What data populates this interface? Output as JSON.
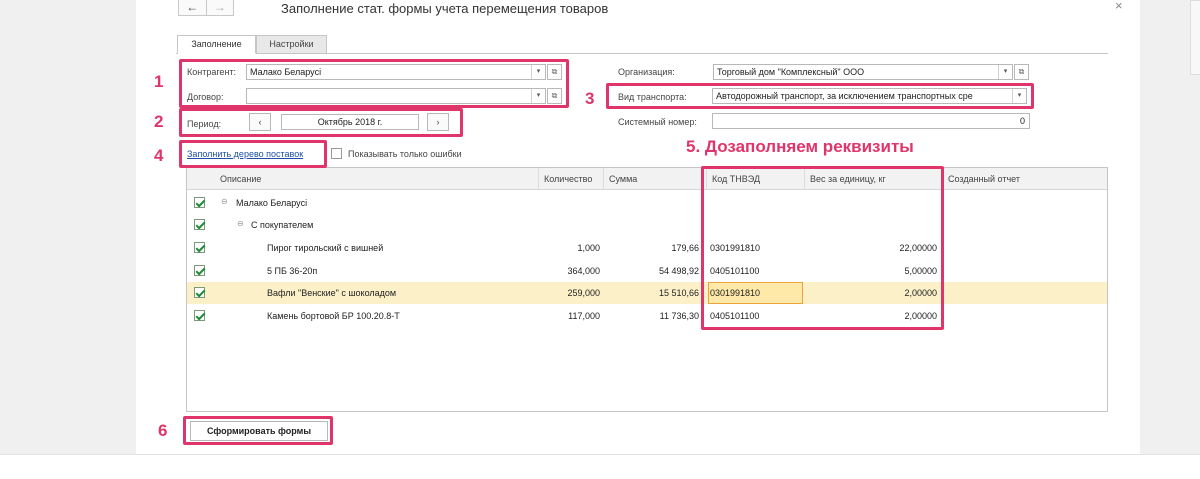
{
  "window": {
    "title": "Заполнение стат. формы учета перемещения товаров",
    "nav_back": "←",
    "nav_forward": "→",
    "close": "×"
  },
  "tabs": [
    {
      "label": "Заполнение",
      "active": true
    },
    {
      "label": "Настройки",
      "active": false
    }
  ],
  "form": {
    "counterparty_label": "Контрагент:",
    "counterparty_value": "Малако Беларусі",
    "contract_label": "Договор:",
    "contract_value": "",
    "period_label": "Период:",
    "period_value": "Октябрь 2018 г.",
    "period_prev": "‹",
    "period_next": "›",
    "org_label": "Организация:",
    "org_value": "Торговый дом \"Комплексный\" ООО",
    "transport_label": "Вид транспорта:",
    "transport_value": "Автодорожный транспорт, за исключением транспортных сре",
    "sysnum_label": "Системный номер:",
    "sysnum_value": "0",
    "fill_tree_link": "Заполнить дерево поставок",
    "only_errors_label": "Показывать только ошибки",
    "dropdown_glyph": "▾",
    "open_glyph": "⧉"
  },
  "annotations": {
    "n1": "1",
    "n2": "2",
    "n3": "3",
    "n4": "4",
    "n5": "5. Дозаполняем реквизиты",
    "n6": "6",
    "accent_color": "#e0356a"
  },
  "table": {
    "headers": [
      "Описание",
      "Количество",
      "Сумма",
      "Код ТНВЭД",
      "Вес за единицу, кг",
      "Созданный отчет"
    ],
    "group1": "Малако Беларусі",
    "group2": "С покупателем",
    "rows": [
      {
        "desc": "Пирог тирольский с вишней",
        "qty": "1,000",
        "sum": "179,66",
        "code": "0301991810",
        "weight": "22,00000",
        "report": ""
      },
      {
        "desc": "5 ПБ 36-20п",
        "qty": "364,000",
        "sum": "54 498,92",
        "code": "0405101100",
        "weight": "5,00000",
        "report": ""
      },
      {
        "desc": "Вафли \"Венские\" с шоколадом",
        "qty": "259,000",
        "sum": "15 510,66",
        "code": "0301991810",
        "weight": "2,00000",
        "report": ""
      },
      {
        "desc": "Камень бортовой БР 100.20.8-Т",
        "qty": "117,000",
        "sum": "11 736,30",
        "code": "0405101100",
        "weight": "2,00000",
        "report": ""
      }
    ]
  },
  "actions": {
    "submit": "Сформировать формы"
  }
}
